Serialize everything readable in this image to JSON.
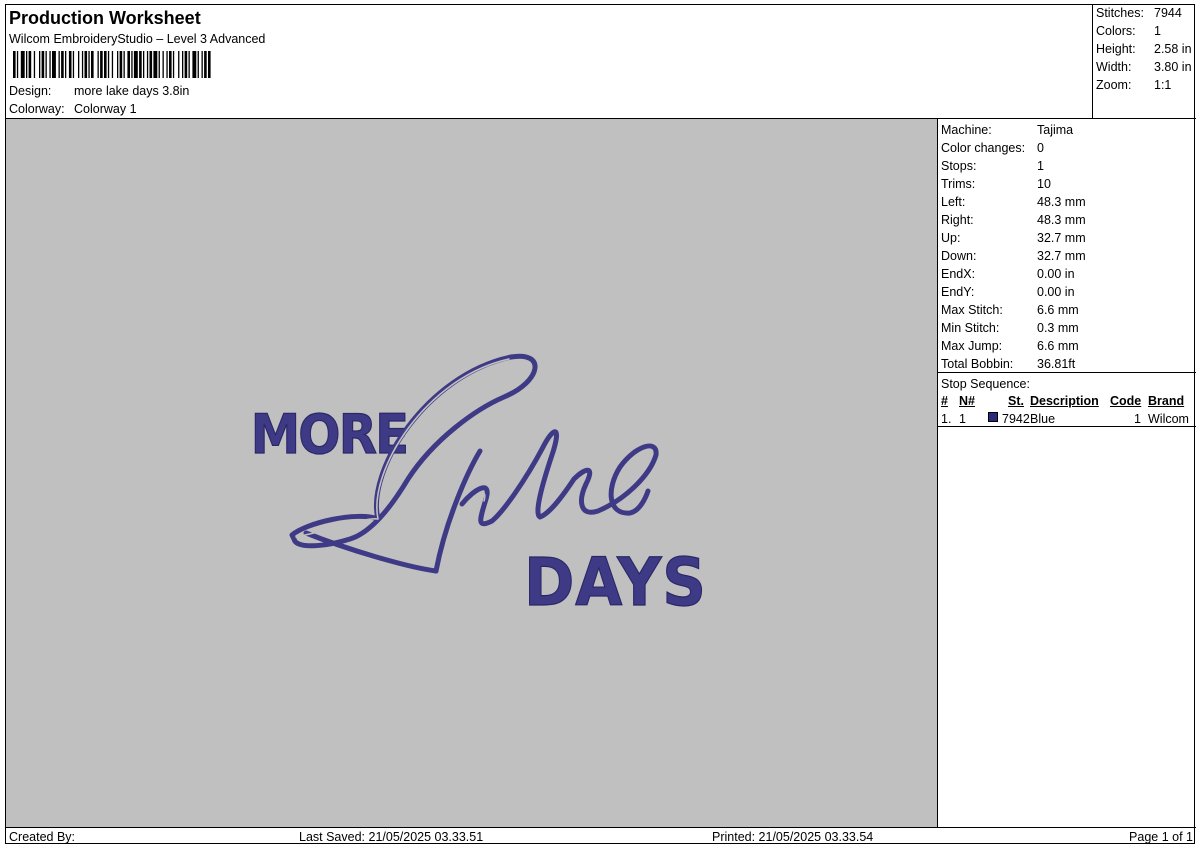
{
  "header": {
    "title": "Production Worksheet",
    "subtitle": "Wilcom EmbroideryStudio – Level 3 Advanced",
    "design_label": "Design:",
    "design_value": "more lake days 3.8in",
    "colorway_label": "Colorway:",
    "colorway_value": "Colorway 1"
  },
  "summary": {
    "rows": [
      {
        "label": "Stitches:",
        "value": "7944"
      },
      {
        "label": "Colors:",
        "value": "1"
      },
      {
        "label": "Height:",
        "value": "2.58 in"
      },
      {
        "label": "Width:",
        "value": "3.80 in"
      },
      {
        "label": "Zoom:",
        "value": "1:1"
      }
    ]
  },
  "design": {
    "word_top": "MORE",
    "word_script": "Lake",
    "word_bottom": "DAYS",
    "thread_color": "#3f3a86",
    "thread_shadow": "#2b2767",
    "background": "#c0c0c0"
  },
  "machine_info": {
    "rows": [
      {
        "label": "Machine:",
        "value": "Tajima"
      },
      {
        "label": "Color changes:",
        "value": "0"
      },
      {
        "label": "Stops:",
        "value": "1"
      },
      {
        "label": "Trims:",
        "value": "10"
      },
      {
        "label": "Left:",
        "value": "48.3 mm"
      },
      {
        "label": "Right:",
        "value": "48.3 mm"
      },
      {
        "label": "Up:",
        "value": "32.7 mm"
      },
      {
        "label": "Down:",
        "value": "32.7 mm"
      },
      {
        "label": "EndX:",
        "value": "0.00 in"
      },
      {
        "label": "EndY:",
        "value": "0.00 in"
      },
      {
        "label": "Max Stitch:",
        "value": "6.6 mm"
      },
      {
        "label": "Min Stitch:",
        "value": "0.3 mm"
      },
      {
        "label": "Max Jump:",
        "value": "6.6 mm"
      },
      {
        "label": "Total Bobbin:",
        "value": "36.81ft"
      }
    ]
  },
  "stop_sequence": {
    "title": "Stop Sequence:",
    "headers": {
      "num": "#",
      "n": "N#",
      "st": "St.",
      "description": "Description",
      "code": "Code",
      "brand": "Brand"
    },
    "rows": [
      {
        "num": "1.",
        "n": "1",
        "st": "7942",
        "description": "Blue",
        "code": "1",
        "brand": "Wilcom",
        "swatch": "#2a2a7a"
      }
    ]
  },
  "footer": {
    "created_by": "Created By:",
    "last_saved": "Last Saved: 21/05/2025 03.33.51",
    "printed": "Printed: 21/05/2025 03.33.54",
    "page": "Page 1 of 1"
  }
}
